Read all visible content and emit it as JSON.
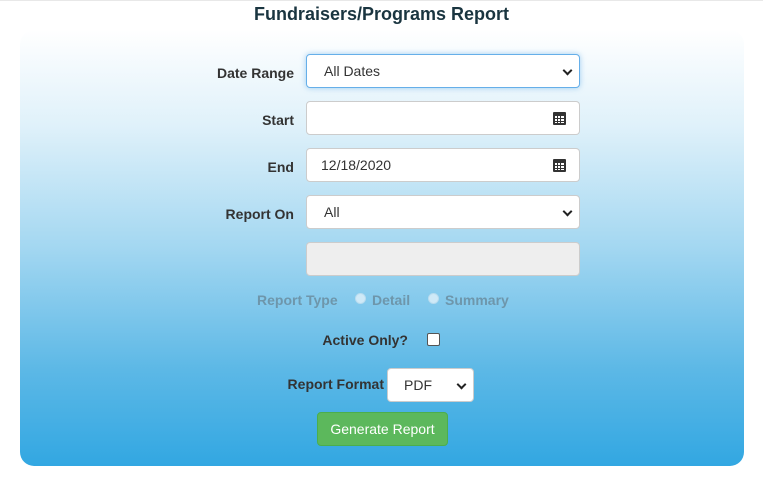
{
  "page": {
    "title": "Fundraisers/Programs Report"
  },
  "form": {
    "date_range": {
      "label": "Date Range",
      "value": "All Dates"
    },
    "start": {
      "label": "Start",
      "value": ""
    },
    "end": {
      "label": "End",
      "value": "12/18/2020"
    },
    "report_on": {
      "label": "Report On",
      "value": "All"
    },
    "report_type": {
      "label": "Report Type",
      "options": [
        "Detail",
        "Summary"
      ]
    },
    "active_only": {
      "label": "Active Only?",
      "checked": false
    },
    "report_format": {
      "label": "Report Format",
      "value": "PDF"
    },
    "generate_button": "Generate Report"
  },
  "icons": {
    "calendar": "calendar-icon",
    "chevron": "chevron-down-icon"
  },
  "colors": {
    "panel_top": "#ffffff",
    "panel_bottom": "#32a7e2",
    "button": "#5cb85c",
    "title": "#1a3540"
  }
}
